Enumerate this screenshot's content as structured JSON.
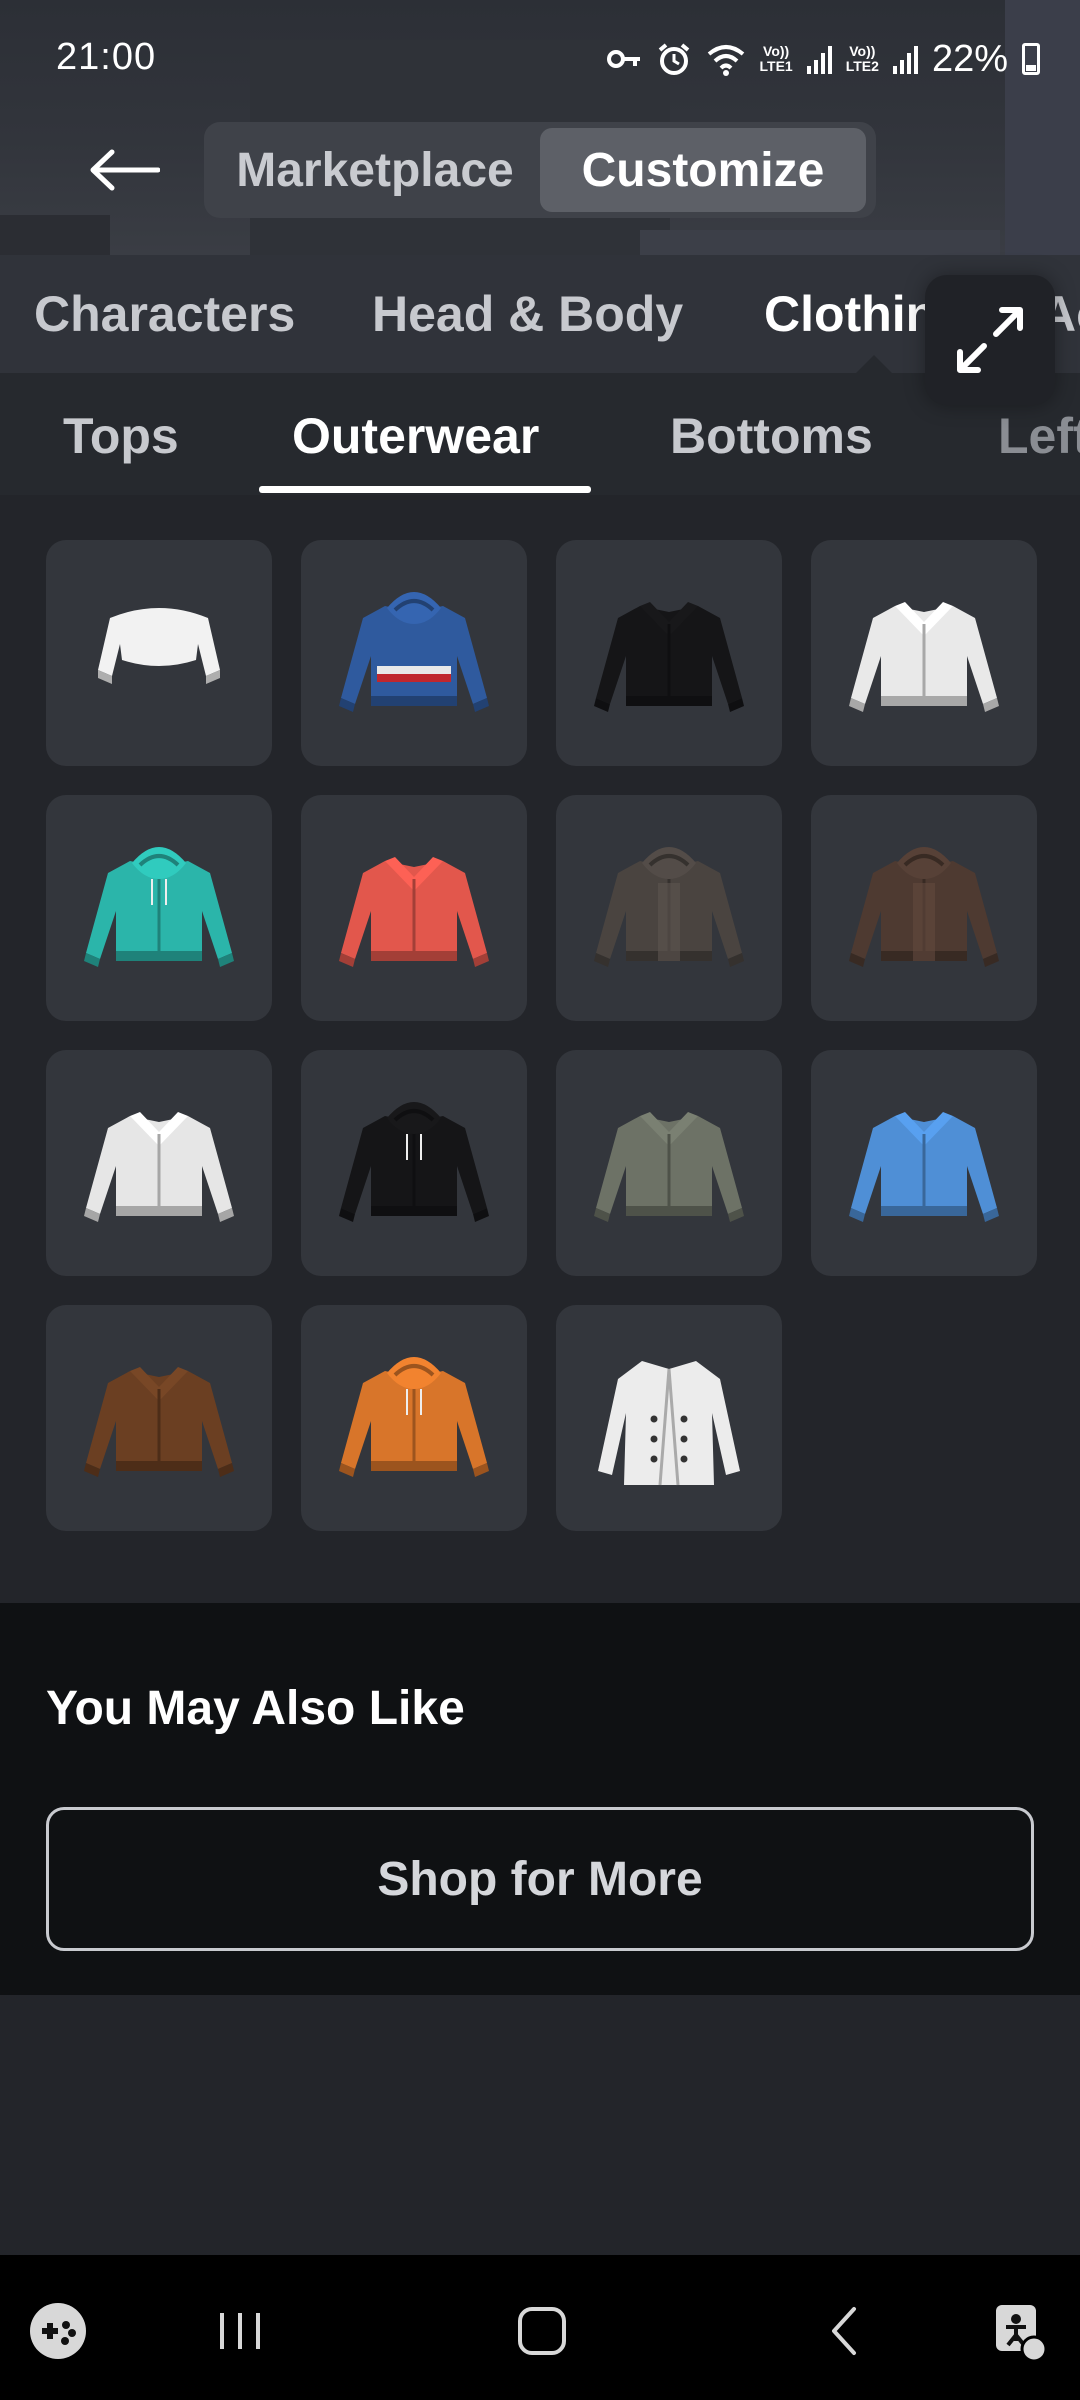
{
  "status_bar": {
    "time": "21:00",
    "sim1_label_top": "Vo))",
    "sim1_label_bottom": "LTE1",
    "sim2_label_top": "Vo))",
    "sim2_label_bottom": "LTE2",
    "battery_percent": "22%",
    "icons": [
      "vpn-key-icon",
      "alarm-icon",
      "wifi-icon",
      "signal-icon",
      "signal-icon",
      "battery-icon"
    ]
  },
  "header": {
    "back_icon": "arrow-left-icon",
    "modes": [
      {
        "label": "Marketplace",
        "selected": false
      },
      {
        "label": "Customize",
        "selected": true
      }
    ]
  },
  "category_tabs": [
    {
      "label": "Characters",
      "selected": false
    },
    {
      "label": "Head & Body",
      "selected": false
    },
    {
      "label": "Clothing",
      "selected": true
    },
    {
      "label": "Accessories",
      "selected": false
    }
  ],
  "expand_button_icon": "expand-arrows-icon",
  "sub_tabs": [
    {
      "label": "Tops",
      "selected": false
    },
    {
      "label": "Outerwear",
      "selected": true
    },
    {
      "label": "Bottoms",
      "selected": false
    },
    {
      "label": "Left Shoe",
      "selected": false
    }
  ],
  "items": [
    {
      "kind": "crop-top",
      "color": "#f2f2f2"
    },
    {
      "kind": "hoodie",
      "color": "#2f5a9e"
    },
    {
      "kind": "jacket",
      "color": "#151517"
    },
    {
      "kind": "shirt",
      "color": "#e9e9e9"
    },
    {
      "kind": "hoodie-open",
      "color": "#2bb5aa"
    },
    {
      "kind": "blazer",
      "color": "#e2574c"
    },
    {
      "kind": "parka",
      "color": "#4a4440"
    },
    {
      "kind": "parka",
      "color": "#4e3a31"
    },
    {
      "kind": "jacket",
      "color": "#e6e6e6"
    },
    {
      "kind": "hoodie-open",
      "color": "#151517"
    },
    {
      "kind": "blazer",
      "color": "#6d7266"
    },
    {
      "kind": "jacket",
      "color": "#4f8fd6"
    },
    {
      "kind": "jacket",
      "color": "#6b3f22"
    },
    {
      "kind": "hoodie-open",
      "color": "#d8752a"
    },
    {
      "kind": "coat",
      "color": "#ececec"
    }
  ],
  "also_like": {
    "title": "You May Also Like",
    "button_label": "Shop for More"
  },
  "nav_bar": {
    "icons": [
      "game-dashboard-icon",
      "recent-apps-icon",
      "home-icon",
      "back-icon",
      "accessibility-icon"
    ]
  }
}
